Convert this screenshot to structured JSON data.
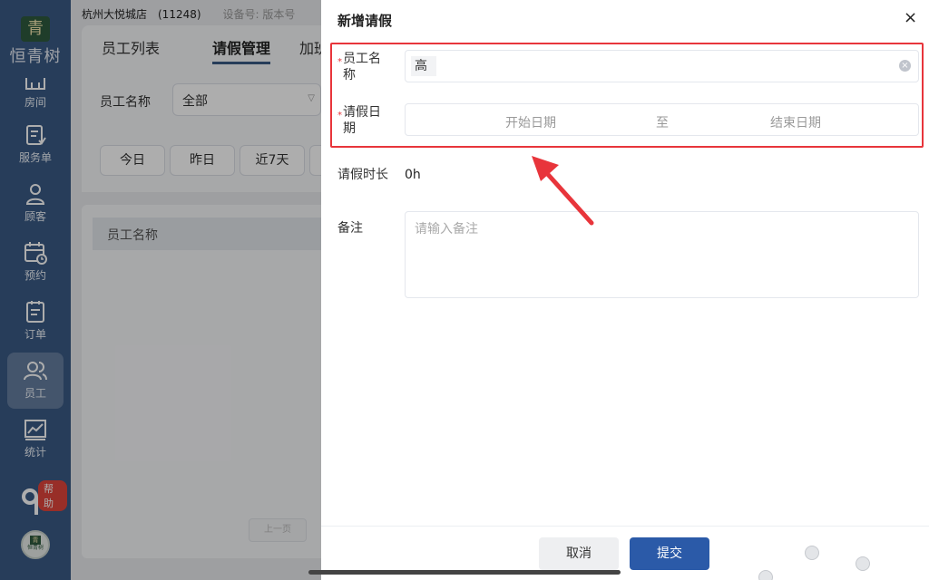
{
  "sidebar": {
    "logo_badge": "青",
    "logo_text": "恒青树",
    "items": [
      {
        "label": "房间",
        "icon": "room-icon"
      },
      {
        "label": "服务单",
        "icon": "service-order-icon"
      },
      {
        "label": "顾客",
        "icon": "customer-icon"
      },
      {
        "label": "预约",
        "icon": "calendar-clock-icon"
      },
      {
        "label": "订单",
        "icon": "order-icon"
      },
      {
        "label": "员工",
        "icon": "staff-icon",
        "active": true
      },
      {
        "label": "统计",
        "icon": "chart-icon"
      }
    ],
    "help_badge": "帮助",
    "avatar_mark": "青",
    "avatar_text": "恒青树"
  },
  "page": {
    "store": "杭州大悦城店　(11248)",
    "device": "设备号: 版本号",
    "tabs": [
      "员工列表",
      "请假管理",
      "加班"
    ],
    "active_tab": 1,
    "filter_label": "员工名称",
    "filter_value": "全部",
    "quick_ranges": [
      "今日",
      "昨日",
      "近7天",
      ""
    ],
    "table_header": "员工名称",
    "prev_page": "上一页"
  },
  "drawer": {
    "title": "新增请假",
    "close_glyph": "×",
    "employee_label_line1": "员工名",
    "employee_label_line2": "称",
    "employee_value": "高",
    "leave_date_label_line1": "请假日",
    "leave_date_label_line2": "期",
    "start_placeholder": "开始日期",
    "range_separator": "至",
    "end_placeholder": "结束日期",
    "duration_label": "请假时长",
    "duration_value": "0h",
    "remark_label": "备注",
    "remark_placeholder": "请输入备注",
    "cancel_label": "取消",
    "submit_label": "提交",
    "required_mark": "*"
  },
  "colors": {
    "sidebar": "#3a5a85",
    "primary": "#2b5aa8",
    "highlight": "#e8353b"
  }
}
